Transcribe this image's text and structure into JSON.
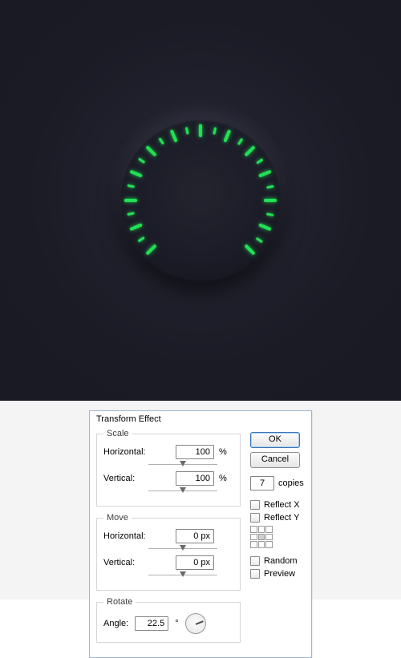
{
  "dial": {
    "tick_color": "#22e055",
    "step_deg": 11.25,
    "long_every": 2,
    "start_deg": -135,
    "end_deg": 135
  },
  "dialog": {
    "title": "Transform Effect",
    "scale": {
      "legend": "Scale",
      "h_label": "Horizontal:",
      "h_value": "100",
      "h_unit": "%",
      "v_label": "Vertical:",
      "v_value": "100",
      "v_unit": "%"
    },
    "move": {
      "legend": "Move",
      "h_label": "Horizontal:",
      "h_value": "0 px",
      "v_label": "Vertical:",
      "v_value": "0 px"
    },
    "rotate": {
      "legend": "Rotate",
      "angle_label": "Angle:",
      "angle_value": "22.5",
      "angle_unit": "°"
    },
    "right": {
      "ok": "OK",
      "cancel": "Cancel",
      "copies_value": "7",
      "copies_label": "copies",
      "reflect_x": "Reflect X",
      "reflect_y": "Reflect Y",
      "random": "Random",
      "preview": "Preview"
    }
  }
}
